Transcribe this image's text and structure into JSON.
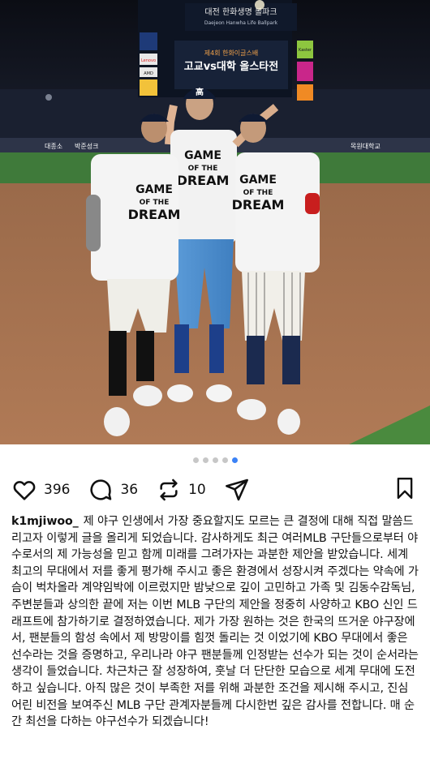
{
  "photo": {
    "stadium_sign_kr": "대전 한화생명 볼파크",
    "stadium_sign_en": "Daejeon Hanwha Life Ballpark",
    "board_event": "제4회 한화이글스배",
    "board_title": "고교vs대학 올스타전",
    "cap_letter": "高",
    "shirt_line1": "GAME",
    "shirt_line2": "OF THE",
    "shirt_line3": "DREAM",
    "banner_items": [
      "대종소",
      "박준성크",
      "목원대학교"
    ],
    "side_ads": [
      "Lenovo",
      "AMD",
      "Kaster"
    ]
  },
  "carousel": {
    "total": 5,
    "active": 5
  },
  "actions": {
    "likes": "396",
    "comments": "36",
    "reposts": "10"
  },
  "post": {
    "username": "k1mjiwoo_",
    "caption": "제 야구 인생에서 가장 중요할지도 모르는 큰 결정에 대해 직접 말씀드리고자 이렇게 글을 올리게 되었습니다. 감사하게도 최근 여러MLB 구단들으로부터 야수로서의 제 가능성을 믿고 함께 미래를 그려가자는 과분한 제안을 받았습니다. 세계 최고의 무대에서 저를 좋게 평가해 주시고 좋은 환경에서 성장시켜 주겠다는 약속에 가슴이 벅차올라 계약임박에 이르렀지만 밤낮으로 깊이 고민하고 가족 및 김동수감독님, 주변분들과 상의한 끝에 저는 이번 MLB 구단의 제안을 정중히 사양하고 KBO 신인 드래프트에 참가하기로 결정하였습니다. 제가 가장 원하는 것은 한국의 뜨거운 야구장에서, 팬분들의 함성 속에서 제 방망이를 힘껏 돌리는 것 이었기에 KBO 무대에서 좋은 선수라는 것을 증명하고, 우리나라 야구 팬분들께 인정받는 선수가 되는 것이 순서라는 생각이 들었습니다. 차근차근 잘 성장하여, 훗날 더 단단한 모습으로 세계 무대에 도전하고 싶습니다. 아직 많은 것이 부족한 저를 위해 과분한 조건을 제시해 주시고, 진심 어린 비전을 보여주신 MLB 구단 관계자분들께 다시한번 깊은 감사를 전합니다. 매 순간 최선을 다하는 야구선수가 되겠습니다!"
  },
  "colors": {
    "accent": "#3b82f6",
    "dot_inactive": "#c7c7c7",
    "text": "#111111"
  }
}
